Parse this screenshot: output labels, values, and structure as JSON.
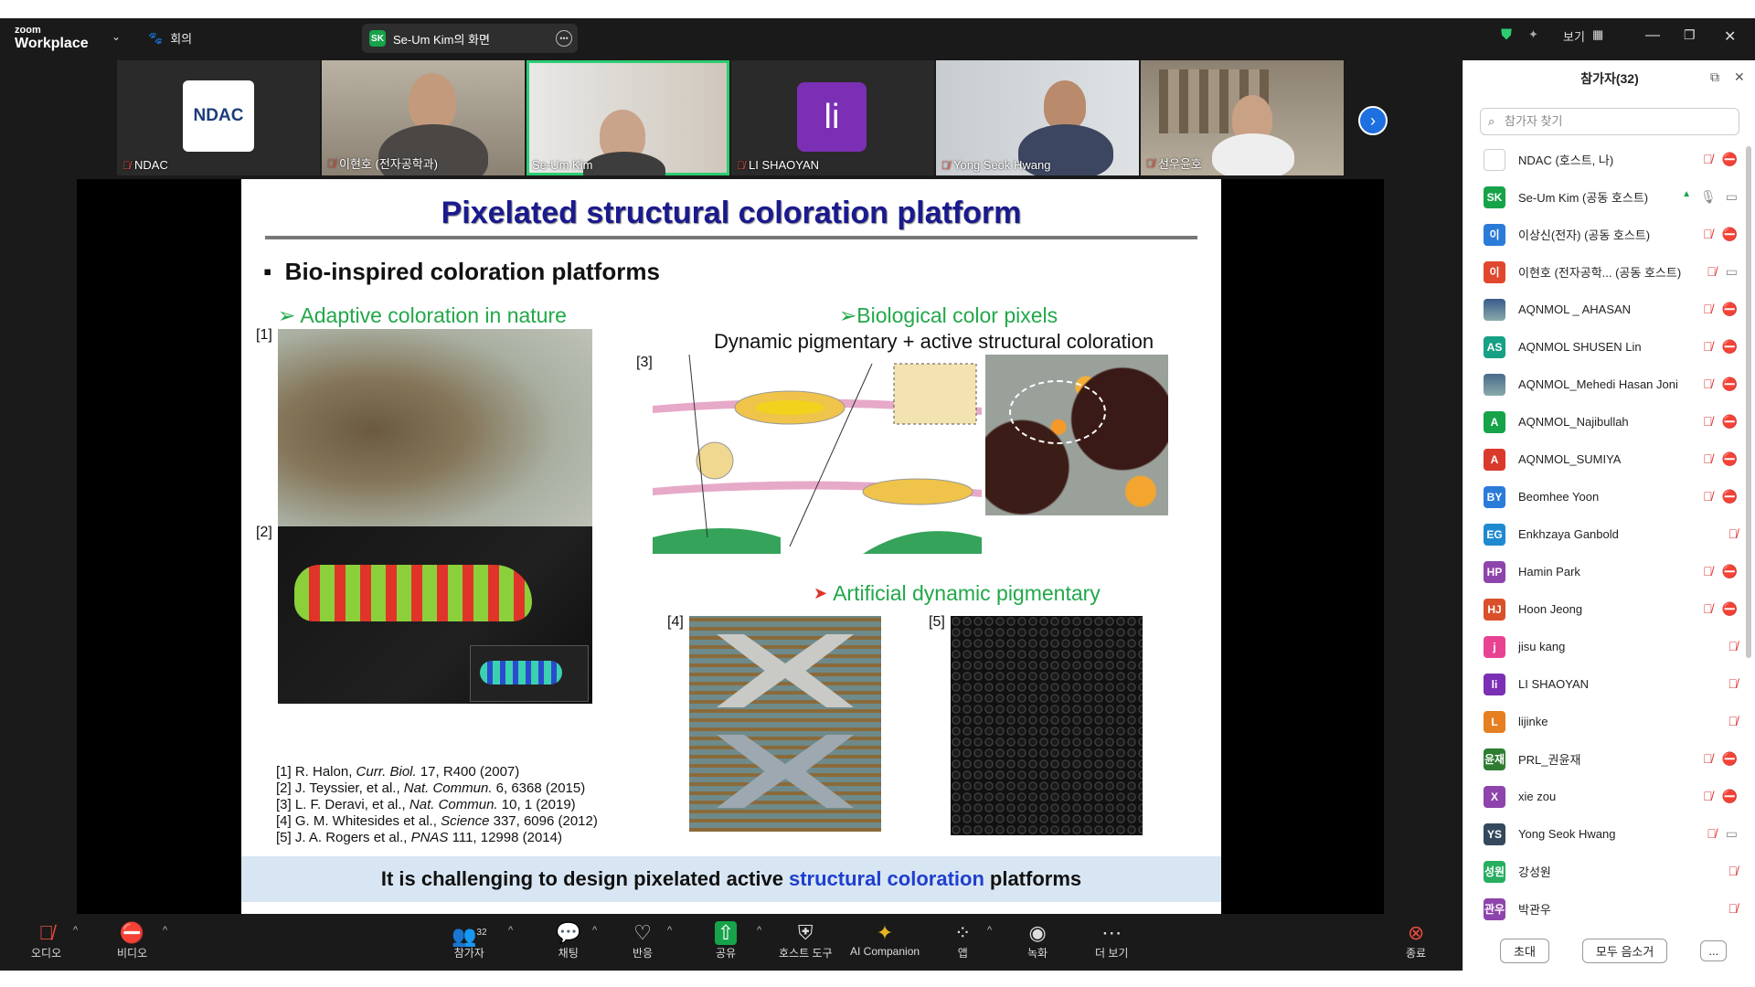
{
  "topbar": {
    "brand_small": "zoom",
    "brand_large": "Workplace",
    "meeting_label": "회의",
    "share_badge": "SK",
    "share_label": "Se-Um Kim의 화면",
    "view_label": "보기"
  },
  "tiles": [
    {
      "name": "NDAC",
      "logo": "NDAC"
    },
    {
      "name": "이현호 (전자공학과)"
    },
    {
      "name": "Se-Um Kim"
    },
    {
      "name": "LI SHAOYAN",
      "initials": "li"
    },
    {
      "name": "Yong Seok Hwang"
    },
    {
      "name": "선우윤호"
    }
  ],
  "slide": {
    "title": "Pixelated structural coloration platform",
    "bullet": "Bio-inspired coloration platforms",
    "adaptive": "➢ Adaptive coloration in nature",
    "biological": "➢Biological color pixels",
    "dynamic": "Dynamic pigmentary + active structural coloration",
    "artificial": "Artificial dynamic pigmentary",
    "ref1": "[1]",
    "ref2": "[2]",
    "ref3": "[3]",
    "ref4": "[4]",
    "ref5": "[5]",
    "citations": [
      {
        "pre": "[1] R. Halon, ",
        "journal": "Curr. Biol.",
        "post": " 17, R400 (2007)"
      },
      {
        "pre": "[2] J. Teyssier, et al., ",
        "journal": "Nat. Commun.",
        "post": " 6, 6368 (2015)"
      },
      {
        "pre": "[3] L. F. Deravi, et al., ",
        "journal": "Nat. Commun.",
        "post": " 10, 1 (2019)"
      },
      {
        "pre": "[4] G. M. Whitesides et al., ",
        "journal": "Science",
        "post": " 337, 6096 (2012)"
      },
      {
        "pre": "[5] J. A. Rogers et al., ",
        "journal": "PNAS",
        "post": " 111, 12998 (2014)"
      }
    ],
    "banner_pre": "It is challenging to design pixelated active",
    "banner_blue": "structural coloration",
    "banner_post": "platforms"
  },
  "toolbar": {
    "audio": "오디오",
    "video": "비디오",
    "participants": "참가자",
    "participants_count": "32",
    "chat": "채팅",
    "react": "반응",
    "share": "공유",
    "host_tools": "호스트 도구",
    "ai": "AI Companion",
    "apps": "앱",
    "record": "녹화",
    "more": "더 보기",
    "end": "종료"
  },
  "panel": {
    "title": "참가자(32)",
    "search_placeholder": "참가자 찾기",
    "invite": "초대",
    "mute_all": "모두 음소거",
    "more": "...",
    "participants": [
      {
        "initials": "",
        "name": "NDAC (호스트, 나)",
        "color": "#ffffff",
        "logo": true
      },
      {
        "initials": "SK",
        "name": "Se-Um Kim (공동 호스트)",
        "color": "#16a34a",
        "active": true
      },
      {
        "initials": "이",
        "name": "이상신(전자) (공동 호스트)",
        "color": "#2b7bd9"
      },
      {
        "initials": "이",
        "name": "이현호 (전자공학... (공동 호스트)",
        "color": "#e0472f",
        "video": true
      },
      {
        "initials": "",
        "name": "AQNMOL _ AHASAN",
        "color": "#3a5a8a",
        "photo": true
      },
      {
        "initials": "AS",
        "name": "AQNMOL SHUSEN Lin",
        "color": "#16a085"
      },
      {
        "initials": "",
        "name": "AQNMOL_Mehedi Hasan Joni",
        "color": "#4a6a8a",
        "photo": true
      },
      {
        "initials": "A",
        "name": "AQNMOL_Najibullah",
        "color": "#16a34a"
      },
      {
        "initials": "A",
        "name": "AQNMOL_SUMIYA",
        "color": "#d93a2b"
      },
      {
        "initials": "BY",
        "name": "Beomhee Yoon",
        "color": "#2b7bd9"
      },
      {
        "initials": "EG",
        "name": "Enkhzaya Ganbold",
        "color": "#1f8ad0",
        "noVideoIcon": true
      },
      {
        "initials": "HP",
        "name": "Hamin Park",
        "color": "#8e44ad"
      },
      {
        "initials": "HJ",
        "name": "Hoon Jeong",
        "color": "#d9502b"
      },
      {
        "initials": "j",
        "name": "jisu kang",
        "color": "#e84393",
        "noVideoIcon": true
      },
      {
        "initials": "li",
        "name": "LI SHAOYAN",
        "color": "#7b2fb5",
        "noVideoIcon": true
      },
      {
        "initials": "L",
        "name": "lijinke",
        "color": "#e67e22",
        "noVideoIcon": true
      },
      {
        "initials": "윤재",
        "name": "PRL_권윤재",
        "color": "#2e7d32"
      },
      {
        "initials": "X",
        "name": "xie zou",
        "color": "#8e44ad"
      },
      {
        "initials": "YS",
        "name": "Yong Seok Hwang",
        "color": "#34495e",
        "video": true
      },
      {
        "initials": "성원",
        "name": "강성원",
        "color": "#27ae60",
        "noVideoIcon": true
      },
      {
        "initials": "관우",
        "name": "박관우",
        "color": "#8e44ad",
        "noVideoIcon": true
      }
    ]
  }
}
